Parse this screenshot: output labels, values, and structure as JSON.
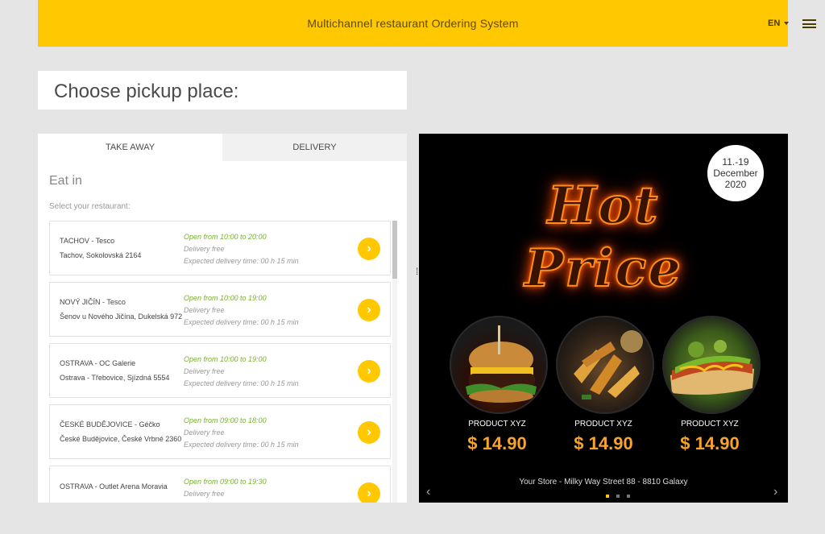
{
  "header": {
    "title": "Multichannel restaurant Ordering System",
    "lang": "EN",
    "brand_color": "#ffc800"
  },
  "pickup": {
    "heading": "Choose pickup place:"
  },
  "tabs": [
    {
      "label": "TAKE AWAY",
      "active": true
    },
    {
      "label": "DELIVERY",
      "active": false
    }
  ],
  "section": {
    "title": "Eat in",
    "subtitle": "Select your restaurant:"
  },
  "restaurants": [
    {
      "name": "TACHOV - Tesco",
      "address": "Tachov, Sokolovská 2164",
      "open": "Open from 10:00 to 20:00",
      "delivery": "Delivery free",
      "time": "Expected delivery time: 00 h 15 min"
    },
    {
      "name": "NOVÝ JIČÍN - Tesco",
      "address": "Šenov u Nového Jičína, Dukelská 972",
      "open": "Open from 10:00 to 19:00",
      "delivery": "Delivery free",
      "time": "Expected delivery time: 00 h 15 min"
    },
    {
      "name": "OSTRAVA - OC Galerie",
      "address": "Ostrava - Třebovice, Sjízdná 5554",
      "open": "Open from 10:00 to 19:00",
      "delivery": "Delivery free",
      "time": "Expected delivery time: 00 h 15 min"
    },
    {
      "name": "ČESKÉ BUDĚJOVICE - Géčko",
      "address": "České Budějovice, České Vrbné 2360",
      "open": "Open from 09:00 to 18:00",
      "delivery": "Delivery free",
      "time": "Expected delivery time: 00 h 15 min"
    },
    {
      "name": "OSTRAVA - Outlet Arena Moravia",
      "address": "",
      "open": "Open from 09:00 to 19:30",
      "delivery": "Delivery free",
      "time": ""
    }
  ],
  "promo": {
    "date_line1": "11.-19",
    "date_line2": "December",
    "date_line3": "2020",
    "headline1": "Hot",
    "headline2": "Price",
    "products": [
      {
        "name": "PRODUCT XYZ",
        "price": "$ 14.90",
        "icon": "burger-image"
      },
      {
        "name": "PRODUCT XYZ",
        "price": "$ 14.90",
        "icon": "potato-wedges-image"
      },
      {
        "name": "PRODUCT XYZ",
        "price": "$ 14.90",
        "icon": "hotdog-image"
      }
    ],
    "store": "Your Store - Milky Way Street 88 - 8810 Galaxy",
    "prev_icon": "‹",
    "next_icon": "›",
    "slide_count": 3,
    "active_slide": 1
  }
}
